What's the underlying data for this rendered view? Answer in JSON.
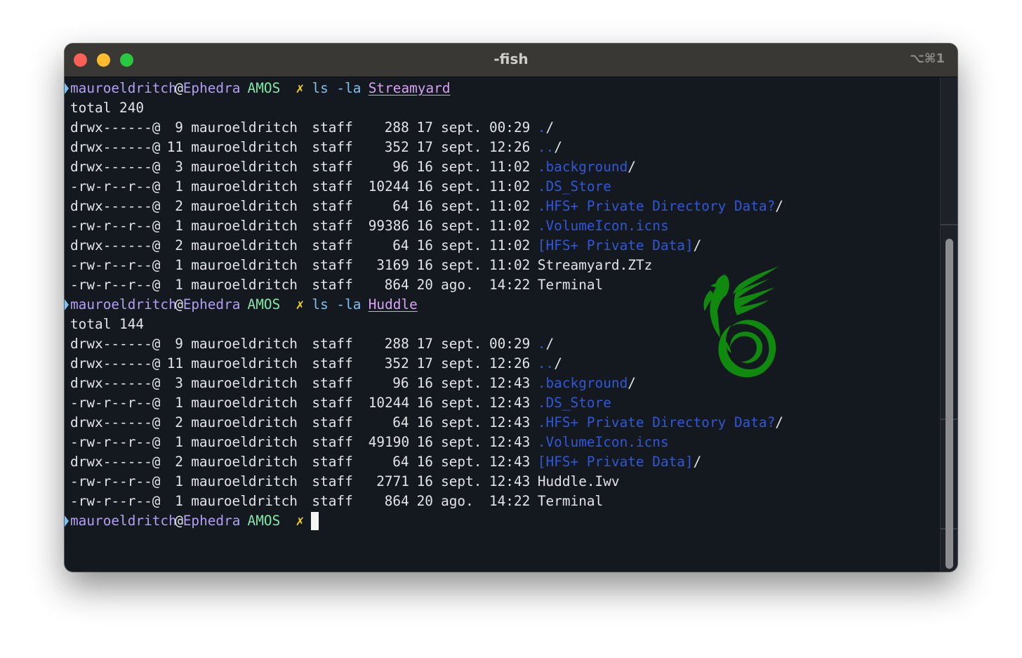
{
  "window": {
    "title": "-fish",
    "shortcut": "⌥⌘1"
  },
  "terminal": {
    "prompts": [
      {
        "user": "mauroeldritch",
        "at": "@",
        "host": "Ephedra",
        "dir": "AMOS",
        "mark": "✗",
        "cmd": "ls -la",
        "arg": "Streamyard"
      },
      {
        "user": "mauroeldritch",
        "at": "@",
        "host": "Ephedra",
        "dir": "AMOS",
        "mark": "✗",
        "cmd": "ls -la",
        "arg": "Huddle"
      },
      {
        "user": "mauroeldritch",
        "at": "@",
        "host": "Ephedra",
        "dir": "AMOS",
        "mark": "✗",
        "cmd": "",
        "arg": ""
      }
    ],
    "listings": [
      {
        "total": "total 240",
        "rows": [
          {
            "perms": "drwx------@",
            "links": "9",
            "owner": "mauroeldritch",
            "group": "staff",
            "size": "288",
            "day": "17",
            "month": "sept.",
            "time": "00:29",
            "name": "./"
          },
          {
            "perms": "drwx------@",
            "links": "11",
            "owner": "mauroeldritch",
            "group": "staff",
            "size": "352",
            "day": "17",
            "month": "sept.",
            "time": "12:26",
            "name": "../"
          },
          {
            "perms": "drwx------@",
            "links": "3",
            "owner": "mauroeldritch",
            "group": "staff",
            "size": "96",
            "day": "16",
            "month": "sept.",
            "time": "11:02",
            "name": ".background/"
          },
          {
            "perms": "-rw-r--r--@",
            "links": "1",
            "owner": "mauroeldritch",
            "group": "staff",
            "size": "10244",
            "day": "16",
            "month": "sept.",
            "time": "11:02",
            "name": ".DS_Store"
          },
          {
            "perms": "drwx------@",
            "links": "2",
            "owner": "mauroeldritch",
            "group": "staff",
            "size": "64",
            "day": "16",
            "month": "sept.",
            "time": "11:02",
            "name": ".HFS+ Private Directory Data?/"
          },
          {
            "perms": "-rw-r--r--@",
            "links": "1",
            "owner": "mauroeldritch",
            "group": "staff",
            "size": "99386",
            "day": "16",
            "month": "sept.",
            "time": "11:02",
            "name": ".VolumeIcon.icns"
          },
          {
            "perms": "drwx------@",
            "links": "2",
            "owner": "mauroeldritch",
            "group": "staff",
            "size": "64",
            "day": "16",
            "month": "sept.",
            "time": "11:02",
            "name": "[HFS+ Private Data]/"
          },
          {
            "perms": "-rw-r--r--@",
            "links": "1",
            "owner": "mauroeldritch",
            "group": "staff",
            "size": "3169",
            "day": "16",
            "month": "sept.",
            "time": "11:02",
            "name": "Streamyard.ZTz"
          },
          {
            "perms": "-rw-r--r--@",
            "links": "1",
            "owner": "mauroeldritch",
            "group": "staff",
            "size": "864",
            "day": "20",
            "month": "ago.",
            "time": "14:22",
            "name": "Terminal"
          }
        ]
      },
      {
        "total": "total 144",
        "rows": [
          {
            "perms": "drwx------@",
            "links": "9",
            "owner": "mauroeldritch",
            "group": "staff",
            "size": "288",
            "day": "17",
            "month": "sept.",
            "time": "00:29",
            "name": "./"
          },
          {
            "perms": "drwx------@",
            "links": "11",
            "owner": "mauroeldritch",
            "group": "staff",
            "size": "352",
            "day": "17",
            "month": "sept.",
            "time": "12:26",
            "name": "../"
          },
          {
            "perms": "drwx------@",
            "links": "3",
            "owner": "mauroeldritch",
            "group": "staff",
            "size": "96",
            "day": "16",
            "month": "sept.",
            "time": "12:43",
            "name": ".background/"
          },
          {
            "perms": "-rw-r--r--@",
            "links": "1",
            "owner": "mauroeldritch",
            "group": "staff",
            "size": "10244",
            "day": "16",
            "month": "sept.",
            "time": "12:43",
            "name": ".DS_Store"
          },
          {
            "perms": "drwx------@",
            "links": "2",
            "owner": "mauroeldritch",
            "group": "staff",
            "size": "64",
            "day": "16",
            "month": "sept.",
            "time": "12:43",
            "name": ".HFS+ Private Directory Data?/"
          },
          {
            "perms": "-rw-r--r--@",
            "links": "1",
            "owner": "mauroeldritch",
            "group": "staff",
            "size": "49190",
            "day": "16",
            "month": "sept.",
            "time": "12:43",
            "name": ".VolumeIcon.icns"
          },
          {
            "perms": "drwx------@",
            "links": "2",
            "owner": "mauroeldritch",
            "group": "staff",
            "size": "64",
            "day": "16",
            "month": "sept.",
            "time": "12:43",
            "name": "[HFS+ Private Data]/"
          },
          {
            "perms": "-rw-r--r--@",
            "links": "1",
            "owner": "mauroeldritch",
            "group": "staff",
            "size": "2771",
            "day": "16",
            "month": "sept.",
            "time": "12:43",
            "name": "Huddle.Iwv"
          },
          {
            "perms": "-rw-r--r--@",
            "links": "1",
            "owner": "mauroeldritch",
            "group": "staff",
            "size": "864",
            "day": "20",
            "month": "ago.",
            "time": "14:22",
            "name": "Terminal"
          }
        ]
      }
    ]
  },
  "colors": {
    "background": "#14181f",
    "user": "#b39ff3",
    "dir": "#7fe8a6",
    "mark": "#f1d21e",
    "cmd": "#7ec0f0",
    "arg": "#d8a2f4",
    "hidden_entry": "#3058d6",
    "text": "#e2e4e8",
    "logo": "#0f8a0f"
  },
  "icons": {
    "prompt_caret": "chevron-right-icon",
    "logo": "bird-logo-icon"
  }
}
